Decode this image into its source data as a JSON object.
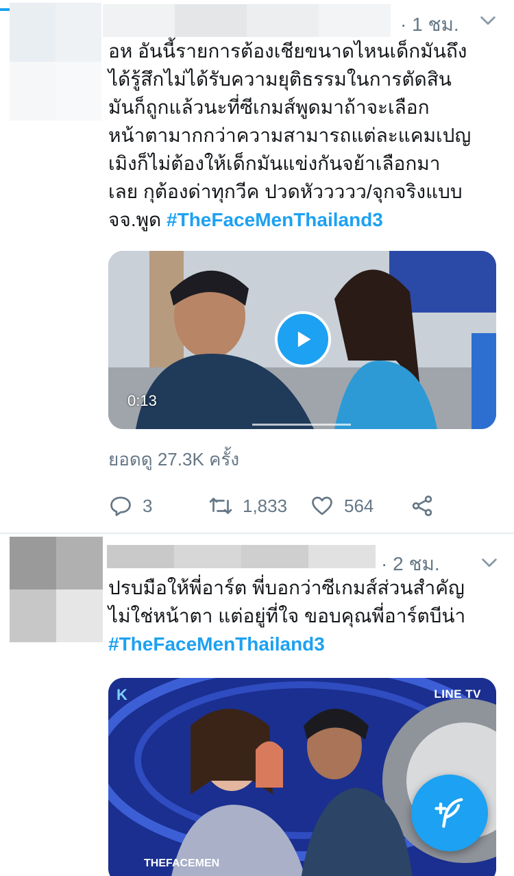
{
  "colors": {
    "accent": "#1da1f2",
    "secondary_text": "#657786",
    "primary_text": "#14171a"
  },
  "tweets": [
    {
      "time": "· 1 ชม.",
      "text_lines": [
        "อห อันนี้รายการต้องเชียขนาดไหนเด็กมันถึง",
        "ได้รู้สึกไม่ได้รับความยุติธรรมในการตัดสิน",
        "มันก็ถูกแล้วนะที่ซีเกมส์พูดมาถ้าจะเลือก",
        "หน้าตามากกว่าความสามารถแต่ละแคมเปญ",
        "เมิงก็ไม่ต้องให้เด็กมันแข่งกันจย้าเลือกมา",
        "เลย กุต้องด่าทุกวีค ปวดหัววววว/จุกจริงแบบ"
      ],
      "last_line_prefix": "จจ.พูด ",
      "hashtag": "#TheFaceMenThailand3",
      "video_duration": "0:13",
      "views": "ยอดดู 27.3K ครั้ง",
      "replies": "3",
      "retweets": "1,833",
      "likes": "564",
      "icons": [
        "reply-icon",
        "retweet-icon",
        "like-icon",
        "share-icon"
      ]
    },
    {
      "time": "· 2 ชม.",
      "text_lines": [
        "ปรบมือให้พี่อาร์ต พี่บอกว่าซีเกมส์ส่วนสำคัญ",
        "ไม่ใช่หน้าตา แต่อยู่ที่ใจ ขอบคุณพี่อาร์ตบีน่า"
      ],
      "hashtag": "#TheFaceMenThailand3",
      "media_badge": "LINE TV",
      "show_logo": "THEFACEMEN"
    }
  ],
  "fab": {
    "icon": "compose-tweet-icon"
  }
}
